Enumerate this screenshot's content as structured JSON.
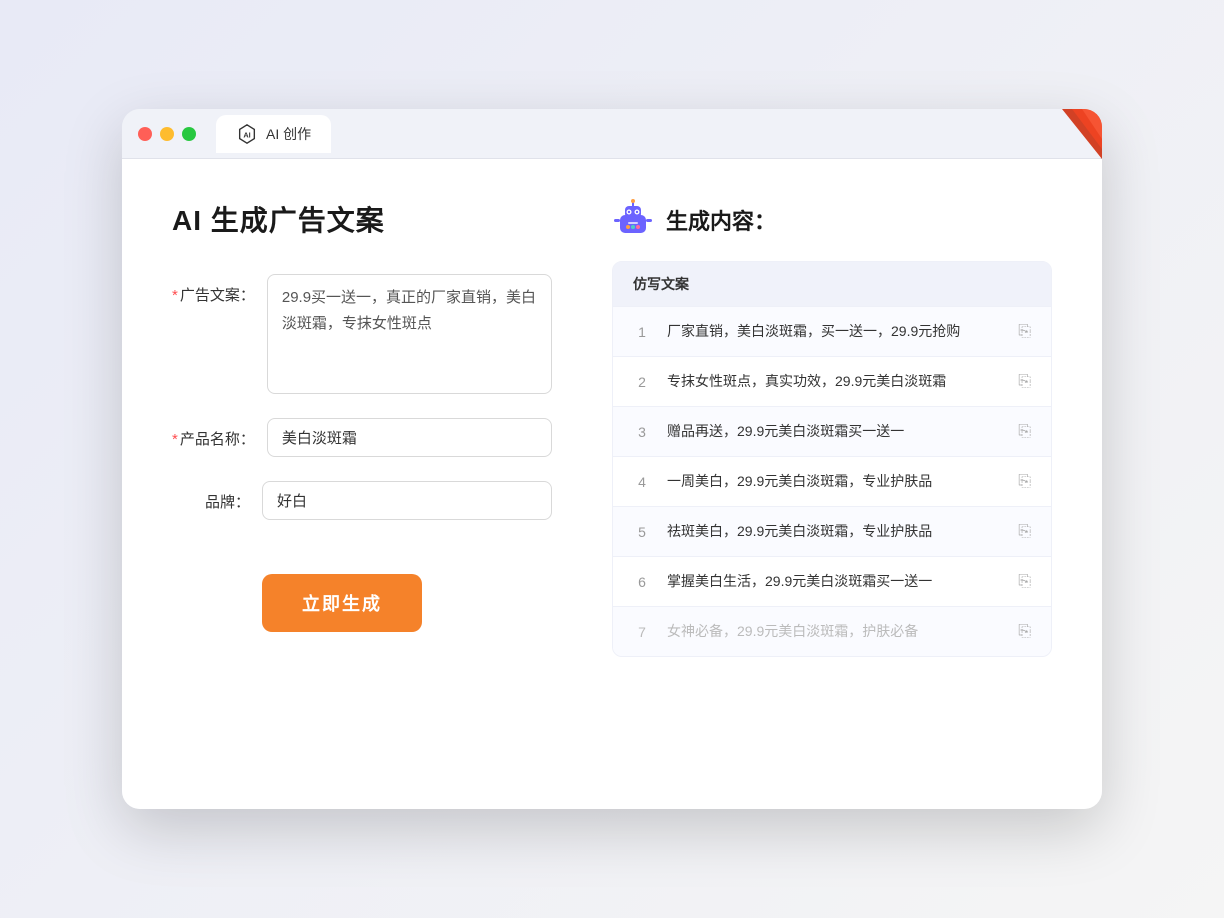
{
  "window": {
    "tab_label": "AI 创作"
  },
  "page": {
    "title": "AI 生成广告文案"
  },
  "form": {
    "ad_copy_label": "广告文案：",
    "ad_copy_required": "*",
    "ad_copy_value": "29.9买一送一，真正的厂家直销，美白淡斑霜，专抹女性斑点",
    "product_name_label": "产品名称：",
    "product_name_required": "*",
    "product_name_value": "美白淡斑霜",
    "brand_label": "品牌：",
    "brand_value": "好白",
    "generate_button": "立即生成"
  },
  "result": {
    "header_label": "生成内容：",
    "table_column": "仿写文案",
    "items": [
      {
        "num": "1",
        "text": "厂家直销，美白淡斑霜，买一送一，29.9元抢购",
        "muted": false
      },
      {
        "num": "2",
        "text": "专抹女性斑点，真实功效，29.9元美白淡斑霜",
        "muted": false
      },
      {
        "num": "3",
        "text": "赠品再送，29.9元美白淡斑霜买一送一",
        "muted": false
      },
      {
        "num": "4",
        "text": "一周美白，29.9元美白淡斑霜，专业护肤品",
        "muted": false
      },
      {
        "num": "5",
        "text": "祛斑美白，29.9元美白淡斑霜，专业护肤品",
        "muted": false
      },
      {
        "num": "6",
        "text": "掌握美白生活，29.9元美白淡斑霜买一送一",
        "muted": false
      },
      {
        "num": "7",
        "text": "女神必备，29.9元美白淡斑霜，护肤必备",
        "muted": true
      }
    ]
  }
}
